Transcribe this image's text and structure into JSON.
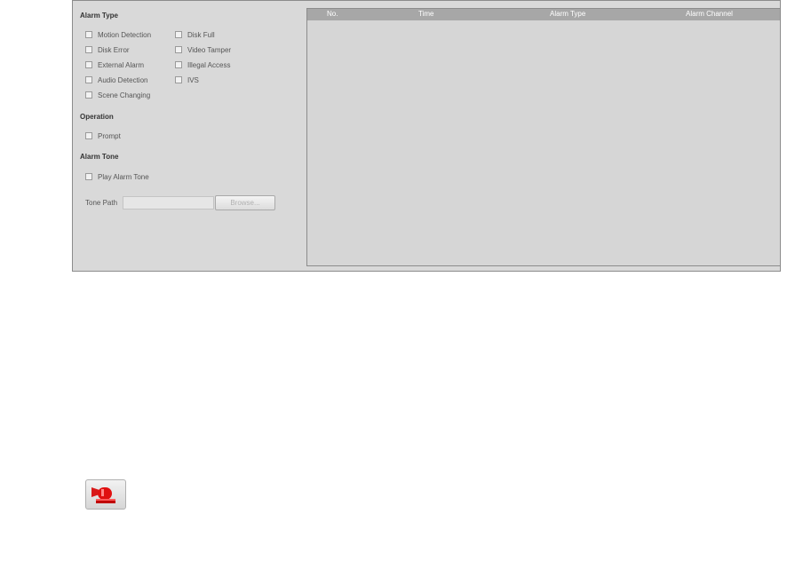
{
  "alarm_type": {
    "title": "Alarm Type",
    "left_col": [
      "Motion Detection",
      "Disk Error",
      "External Alarm",
      "Audio Detection",
      "Scene Changing"
    ],
    "right_col": [
      "Disk Full",
      "Video Tamper",
      "Illegal Access",
      "IVS"
    ]
  },
  "operation": {
    "title": "Operation",
    "prompt_label": "Prompt"
  },
  "alarm_tone": {
    "title": "Alarm Tone",
    "play_label": "Play Alarm Tone",
    "tone_path_label": "Tone Path",
    "tone_path_value": "",
    "browse_label": "Browse..."
  },
  "table": {
    "columns": [
      "No.",
      "Time",
      "Alarm Type",
      "Alarm Channel"
    ],
    "rows": []
  },
  "icons": {
    "alarm_button_icon": "siren-icon"
  },
  "colors": {
    "panel_bg": "#d9d9d9",
    "table_header_bg": "#a7a7a7",
    "siren_red": "#e01010"
  }
}
